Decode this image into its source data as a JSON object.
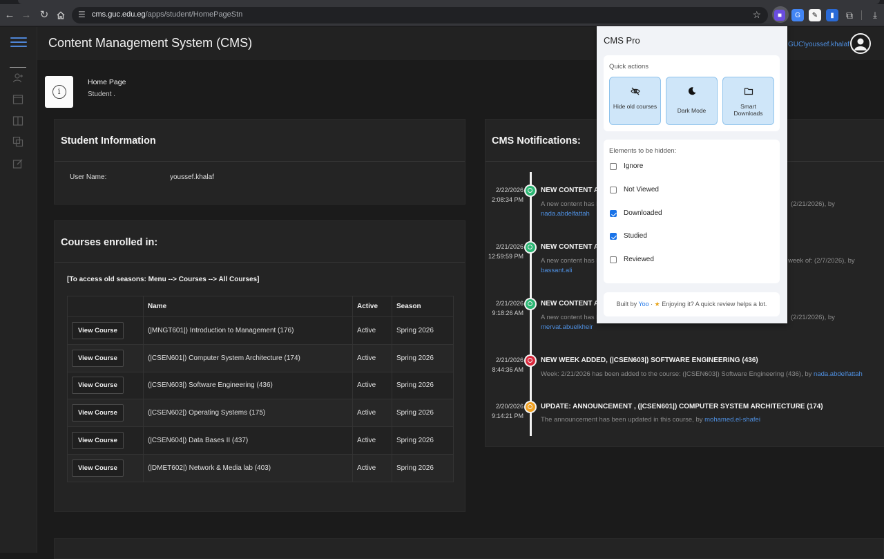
{
  "browser": {
    "url_host": "cms.guc.edu.eg",
    "url_path": "/apps/student/HomePageStn"
  },
  "app": {
    "title": "Content Management System (CMS)",
    "user": "GUC\\youssef.khalaf"
  },
  "page_header": {
    "title": "Home Page",
    "subtitle": "Student ."
  },
  "student_info": {
    "title": "Student Information",
    "user_name_label": "User Name:",
    "user_name_value": "youssef.khalaf"
  },
  "courses": {
    "title": "Courses enrolled in:",
    "note": "[To access old seasons: Menu --> Courses --> All Courses]",
    "headers": [
      "",
      "Name",
      "Active",
      "Season"
    ],
    "button_label": "View Course",
    "rows": [
      {
        "name": "(|MNGT601|) Introduction to Management (176)",
        "active": "Active",
        "season": "Spring 2026"
      },
      {
        "name": "(|CSEN601|) Computer System Architecture (174)",
        "active": "Active",
        "season": "Spring 2026"
      },
      {
        "name": "(|CSEN603|) Software Engineering (436)",
        "active": "Active",
        "season": "Spring 2026"
      },
      {
        "name": "(|CSEN602|) Operating Systems (175)",
        "active": "Active",
        "season": "Spring 2026"
      },
      {
        "name": "(|CSEN604|) Data Bases II (437)",
        "active": "Active",
        "season": "Spring 2026"
      },
      {
        "name": "(|DMET602|) Network & Media lab (403)",
        "active": "Active",
        "season": "Spring 2026"
      }
    ]
  },
  "notifications": {
    "title": "CMS Notifications:",
    "items": [
      {
        "date": "2/22/2026",
        "time": "2:08:34 PM",
        "head": "NEW CONTENT AD",
        "desc": "A new content has b",
        "tail": "(2/21/2026), by",
        "by": "nada.abdelfattah",
        "dot_color": "#2bb673"
      },
      {
        "date": "2/21/2026",
        "time": "12:59:59 PM",
        "head": "NEW CONTENT AD",
        "desc": "A new content has b",
        "tail": "week of: (2/7/2026), by",
        "by": "bassant.ali",
        "dot_color": "#2bb673"
      },
      {
        "date": "2/21/2026",
        "time": "9:18:26 AM",
        "head": "NEW CONTENT AD",
        "desc": "A new content has b",
        "tail": "(2/21/2026), by",
        "by": "mervat.abuelkheir",
        "dot_color": "#2bb673"
      },
      {
        "date": "2/21/2026",
        "time": "8:44:36 AM",
        "head": "NEW WEEK ADDED, (|CSEN603|) SOFTWARE ENGINEERING (436)",
        "desc": "Week: 2/21/2026 has been added to the course: (|CSEN603|) Software Engineering (436), by",
        "by": "nada.abdelfattah",
        "dot_color": "#d9283c"
      },
      {
        "date": "2/20/2026",
        "time": "9:14:21 PM",
        "head": "UPDATE: ANNOUNCEMENT , (|CSEN601|) COMPUTER SYSTEM ARCHITECTURE (174)",
        "desc": "The announcement has been updated in this course, by",
        "by": "mohamed.el-shafei",
        "dot_color": "#f0a020"
      }
    ]
  },
  "popup": {
    "title": "CMS Pro",
    "quick_actions_label": "Quick actions",
    "actions": [
      {
        "label": "Hide old courses",
        "icon": "eye-off-icon"
      },
      {
        "label": "Dark Mode",
        "icon": "moon-icon"
      },
      {
        "label": "Smart Downloads",
        "icon": "folder-icon"
      }
    ],
    "hidden_label": "Elements to be hidden:",
    "options": [
      {
        "label": "Ignore",
        "checked": false
      },
      {
        "label": "Not Viewed",
        "checked": false
      },
      {
        "label": "Downloaded",
        "checked": true
      },
      {
        "label": "Studied",
        "checked": true
      },
      {
        "label": "Reviewed",
        "checked": false
      }
    ],
    "footer_prefix": "Built by",
    "footer_author": "Yoo",
    "footer_suffix": "Enjoying it? A quick review helps a lot."
  }
}
